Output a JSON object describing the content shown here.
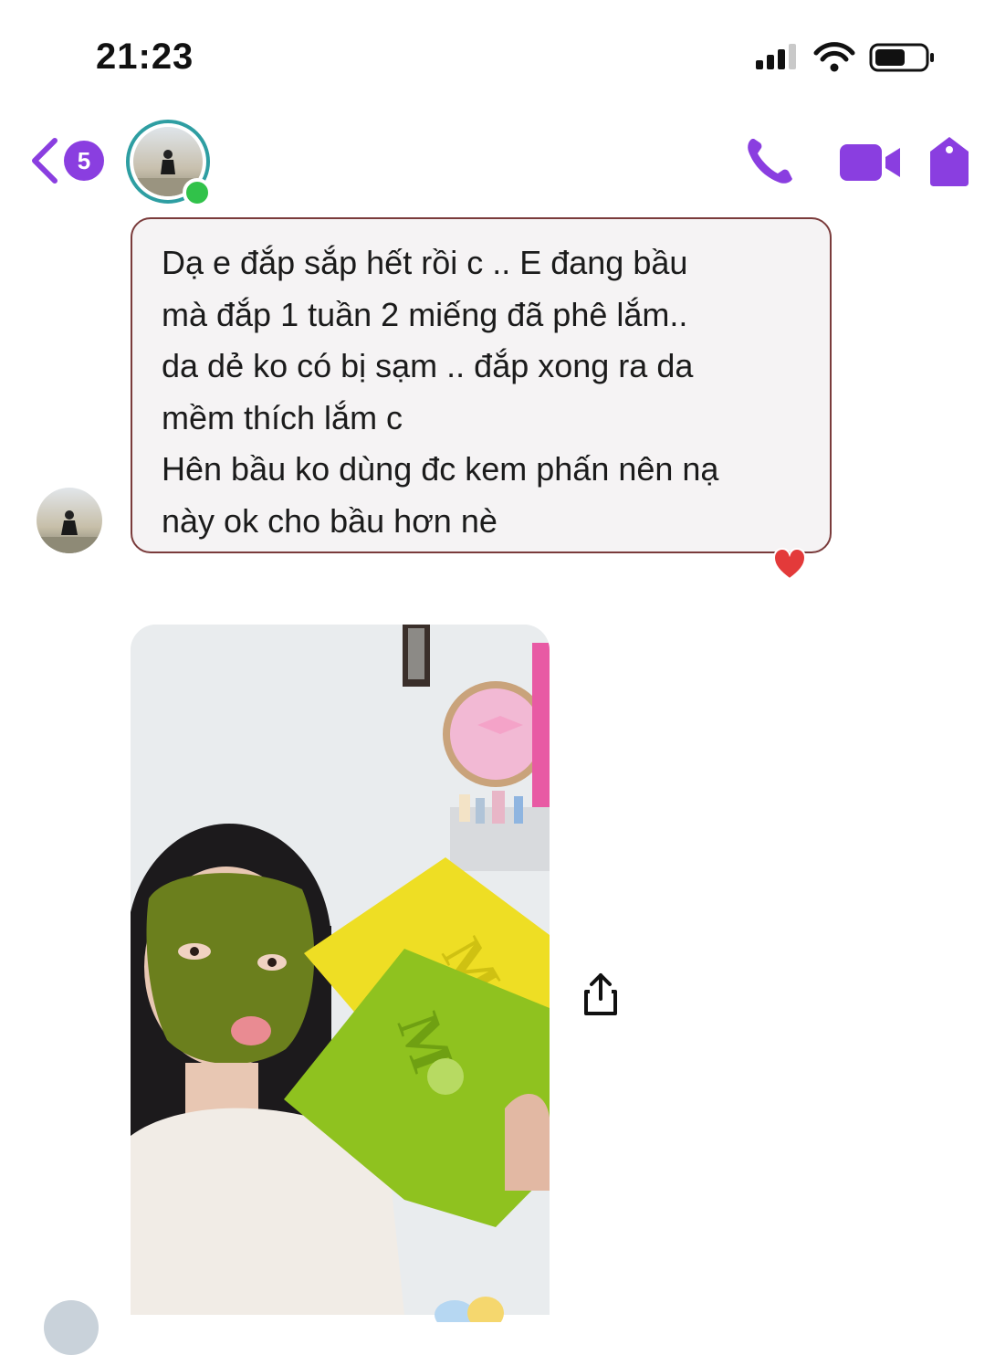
{
  "status_bar": {
    "time": "21:23",
    "signal_icon": "cellular-signal-icon",
    "wifi_icon": "wifi-icon",
    "battery_icon": "battery-icon"
  },
  "header": {
    "back_icon": "chevron-left-icon",
    "unread_count": "5",
    "online": true,
    "actions": [
      "phone-icon",
      "video-camera-icon",
      "tag-icon"
    ],
    "accent_color": "#8a3ee0"
  },
  "messages": [
    {
      "text": "Dạ e đắp sắp hết rồi c .. E đang bầu\nmà đắp 1 tuần 2 miếng đã phê lắm..\nda dẻ ko có bị sạm .. đắp xong ra da\nmềm thích lắm c\nHên bầu ko dùng đc kem phấn nên nạ\nnày ok cho bầu hơn nè",
      "reaction": "heart-icon"
    }
  ],
  "photo_message": {
    "share_icon": "share-icon"
  }
}
